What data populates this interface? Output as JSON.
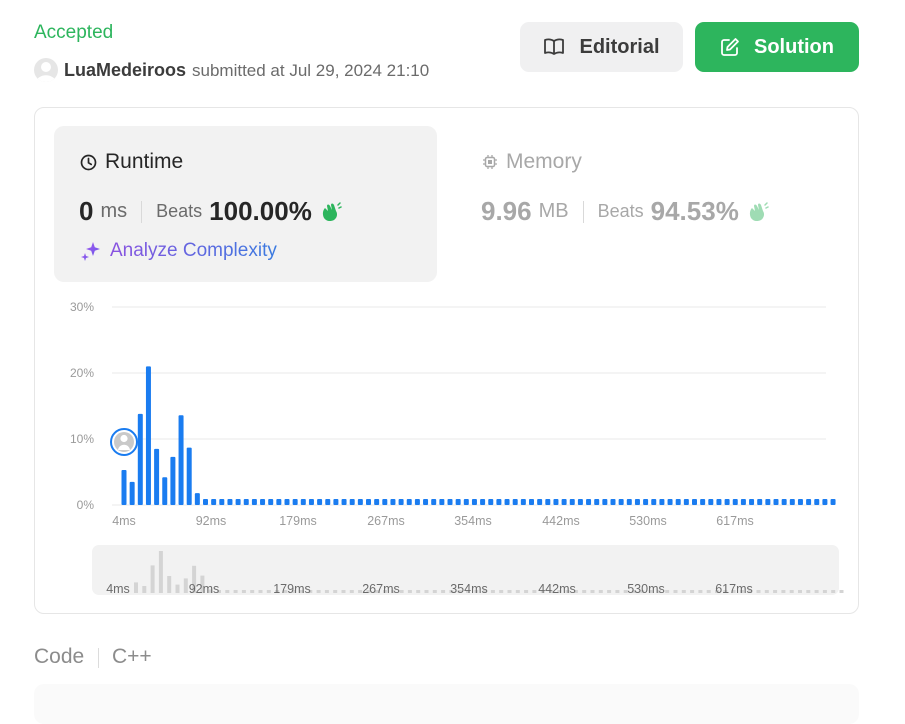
{
  "submission": {
    "status": "Accepted",
    "username": "LuaMedeiroos",
    "submitted_text": "submitted at Jul 29, 2024 21:10"
  },
  "buttons": {
    "editorial": "Editorial",
    "solution": "Solution"
  },
  "runtime": {
    "title": "Runtime",
    "value": "0",
    "unit": "ms",
    "beats_label": "Beats",
    "beats_value": "100.00%",
    "icon": "clock-icon",
    "clap_icon": "clap-icon"
  },
  "memory": {
    "title": "Memory",
    "value": "9.96",
    "unit": "MB",
    "beats_label": "Beats",
    "beats_value": "94.53%",
    "icon": "chip-icon"
  },
  "analyze": {
    "label": "Analyze Complexity",
    "icon": "sparkle-icon"
  },
  "chart_data": {
    "type": "bar",
    "title": "",
    "xlabel": "",
    "ylabel": "",
    "ylim": [
      0,
      30
    ],
    "y_ticks": [
      "30%",
      "20%",
      "10%",
      "0%"
    ],
    "x_ticks": [
      "4ms",
      "92ms",
      "179ms",
      "267ms",
      "354ms",
      "442ms",
      "530ms",
      "617ms"
    ],
    "values": [
      5.3,
      3.5,
      13.8,
      21.0,
      8.5,
      4.2,
      7.3,
      13.6,
      8.7,
      1.8,
      0.9,
      0.9,
      0.9,
      0.9,
      0.9,
      0.9,
      0.9,
      0.9,
      0.9,
      0.9,
      0.9,
      0.9,
      0.9,
      0.9,
      0.9,
      0.9,
      0.9,
      0.9,
      0.9,
      0.9,
      0.9,
      0.9,
      0.9,
      0.9,
      0.9,
      0.9,
      0.9,
      0.9,
      0.9,
      0.9,
      0.9,
      0.9,
      0.9,
      0.9,
      0.9,
      0.9,
      0.9,
      0.9,
      0.9,
      0.9,
      0.9,
      0.9,
      0.9,
      0.9,
      0.9,
      0.9,
      0.9,
      0.9,
      0.9,
      0.9,
      0.9,
      0.9,
      0.9,
      0.9,
      0.9,
      0.9,
      0.9,
      0.9,
      0.9,
      0.9,
      0.9,
      0.9,
      0.9,
      0.9,
      0.9,
      0.9,
      0.9,
      0.9,
      0.9,
      0.9,
      0.9,
      0.9,
      0.9,
      0.9,
      0.9,
      0.9,
      0.9,
      0.9
    ],
    "highlight_index": 0,
    "grid": true,
    "colors": {
      "bar": "#1a7cf0",
      "small_bar": "#0a84ff",
      "grid": "#e8e8e8",
      "navigator_bar": "#d4d4d4"
    }
  },
  "code": {
    "label": "Code",
    "language": "C++"
  },
  "colors": {
    "accent_green": "#2db55d",
    "panel_bg": "#f2f2f2"
  }
}
